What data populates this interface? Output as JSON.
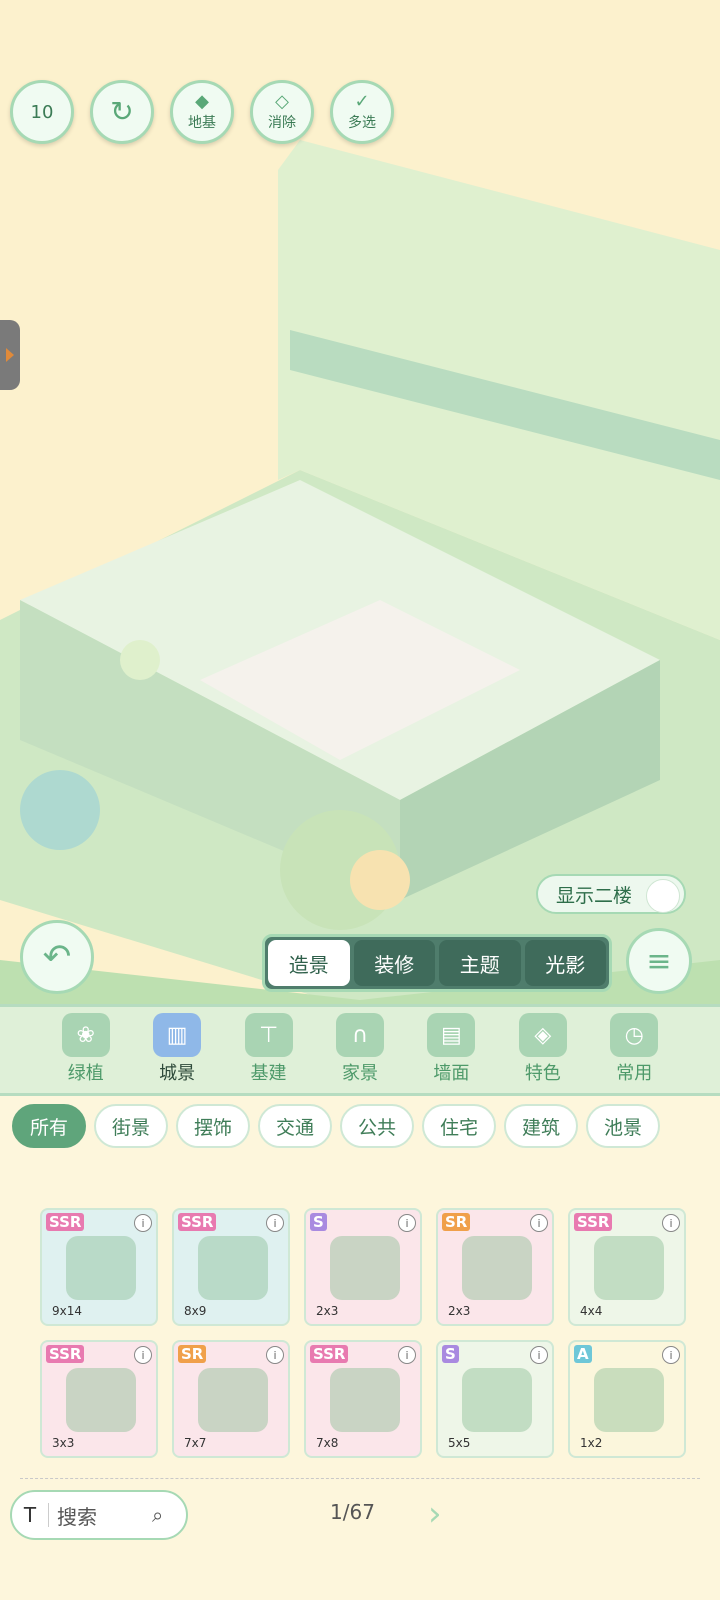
{
  "toolbar": {
    "undo_count": "10",
    "foundation_label": "地基",
    "erase_label": "消除",
    "multiselect_label": "多选"
  },
  "show_second_floor_label": "显示二楼",
  "modes": [
    {
      "label": "造景",
      "active": true
    },
    {
      "label": "装修",
      "active": false
    },
    {
      "label": "主题",
      "active": false
    },
    {
      "label": "光影",
      "active": false
    }
  ],
  "categories": [
    {
      "label": "绿植",
      "icon": "plant-icon"
    },
    {
      "label": "城景",
      "icon": "building-icon",
      "active": true
    },
    {
      "label": "基建",
      "icon": "crane-icon"
    },
    {
      "label": "家景",
      "icon": "arch-icon"
    },
    {
      "label": "墙面",
      "icon": "wall-icon"
    },
    {
      "label": "特色",
      "icon": "cube-icon"
    },
    {
      "label": "常用",
      "icon": "calendar-clock-icon"
    }
  ],
  "subtabs": [
    "所有",
    "街景",
    "摆饰",
    "交通",
    "公共",
    "住宅",
    "建筑",
    "池景"
  ],
  "items": [
    {
      "rarity": "SSR",
      "size": "9x14",
      "bg": "#dff1f0"
    },
    {
      "rarity": "SSR",
      "size": "8x9",
      "bg": "#dff1f0"
    },
    {
      "rarity": "S",
      "size": "2x3",
      "bg": "#fbe6ea"
    },
    {
      "rarity": "SR",
      "size": "2x3",
      "bg": "#fbe6ea"
    },
    {
      "rarity": "SSR",
      "size": "4x4",
      "bg": "#eef6e8"
    },
    {
      "rarity": "SSR",
      "size": "3x3",
      "bg": "#fbe6ea"
    },
    {
      "rarity": "SR",
      "size": "7x7",
      "bg": "#fbe6ea"
    },
    {
      "rarity": "SSR",
      "size": "7x8",
      "bg": "#fbe6ea"
    },
    {
      "rarity": "S",
      "size": "5x5",
      "bg": "#eef6e8"
    },
    {
      "rarity": "A",
      "size": "1x2",
      "bg": "#fbf6dc"
    }
  ],
  "search": {
    "tool_glyph": "T",
    "placeholder": "搜索"
  },
  "pager": "1/67",
  "colors": {
    "accent": "#a6d9b4",
    "active_tab": "#5fa57b",
    "ssr": "#e87ab0",
    "sr": "#f0a04a",
    "s": "#a98ae0",
    "a": "#6ec7d8"
  }
}
